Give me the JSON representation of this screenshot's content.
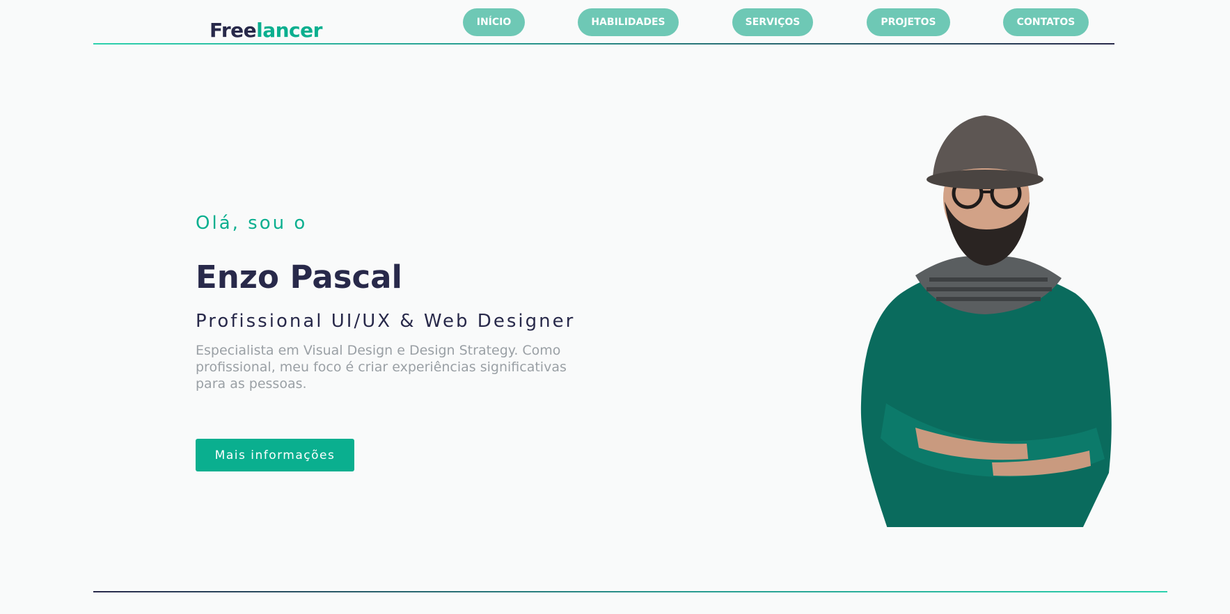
{
  "brand": {
    "part1": "Free",
    "part2": "lancer"
  },
  "nav": [
    {
      "label": "INÍCIO"
    },
    {
      "label": "HABILIDADES"
    },
    {
      "label": "SERVIÇOS"
    },
    {
      "label": "PROJETOS"
    },
    {
      "label": "CONTATOS"
    }
  ],
  "hero": {
    "greeting": "Olá, sou o",
    "name": "Enzo Pascal",
    "role": "Profissional UI/UX & Web Designer",
    "description": "Especialista em Visual Design e Design Strategy. Como profissional, meu foco é criar experiências significativas para as pessoas.",
    "cta": "Mais informações"
  },
  "colors": {
    "accent": "#0aaf8f",
    "nav_button": "#6ec8b5",
    "dark": "#28294a",
    "muted_text": "#9aa0a5",
    "background": "#f9fafa"
  }
}
